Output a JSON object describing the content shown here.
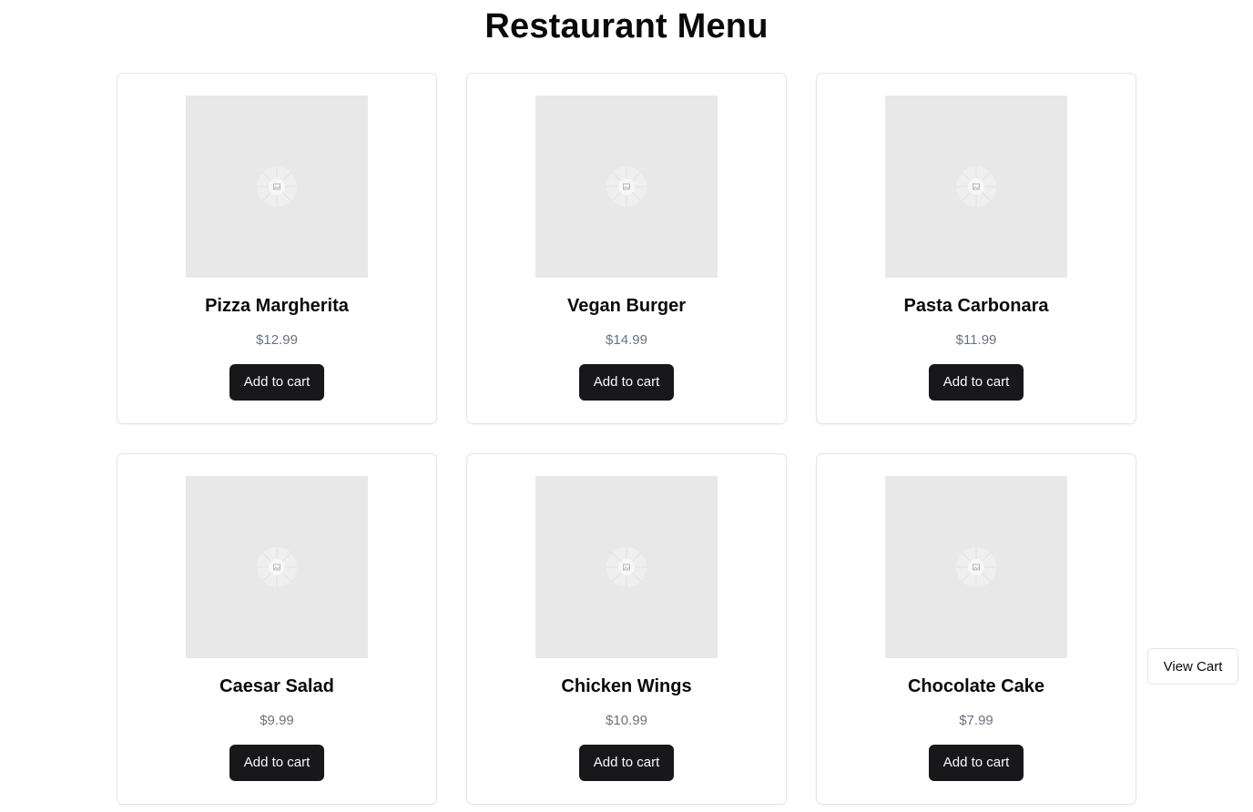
{
  "header": {
    "title": "Restaurant Menu"
  },
  "menu": {
    "items": [
      {
        "name": "Pizza Margherita",
        "price": "$12.99",
        "button_label": "Add to cart",
        "image_icon": "image-placeholder-icon"
      },
      {
        "name": "Vegan Burger",
        "price": "$14.99",
        "button_label": "Add to cart",
        "image_icon": "image-placeholder-icon"
      },
      {
        "name": "Pasta Carbonara",
        "price": "$11.99",
        "button_label": "Add to cart",
        "image_icon": "image-placeholder-icon"
      },
      {
        "name": "Caesar Salad",
        "price": "$9.99",
        "button_label": "Add to cart",
        "image_icon": "image-placeholder-icon"
      },
      {
        "name": "Chicken Wings",
        "price": "$10.99",
        "button_label": "Add to cart",
        "image_icon": "image-placeholder-icon"
      },
      {
        "name": "Chocolate Cake",
        "price": "$7.99",
        "button_label": "Add to cart",
        "image_icon": "image-placeholder-icon"
      }
    ]
  },
  "cart": {
    "view_label": "View Cart"
  },
  "colors": {
    "button_bg": "#18181b",
    "button_text": "#fafafa",
    "price_text": "#6b7280",
    "card_border": "#e4e4e7",
    "image_placeholder": "#e8e8e8"
  }
}
